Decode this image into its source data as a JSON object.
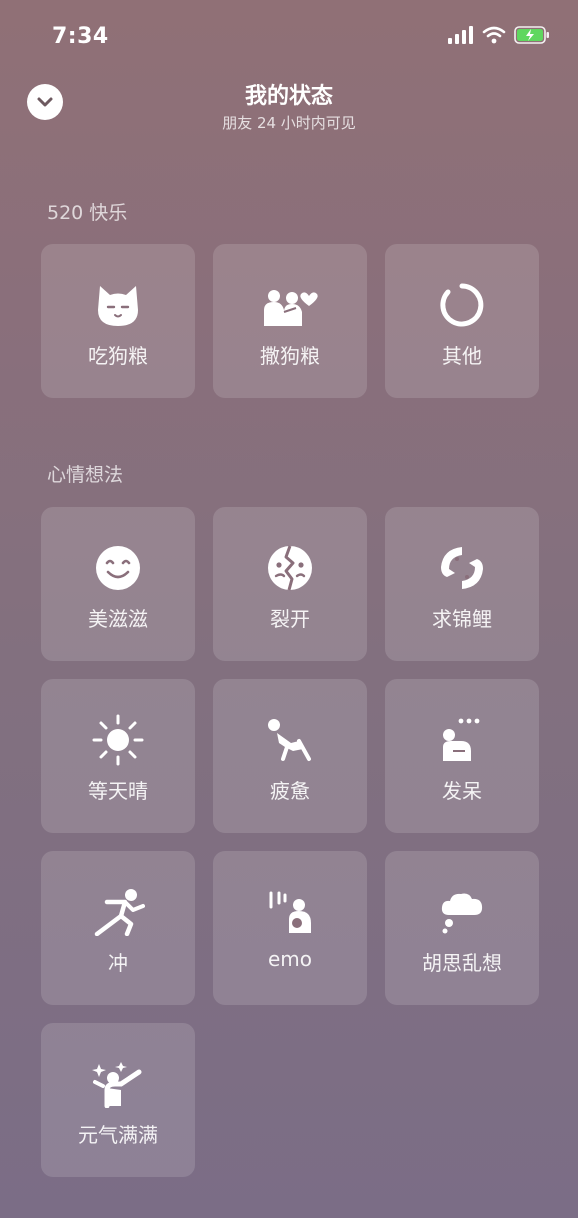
{
  "status_bar": {
    "time": "7:34"
  },
  "header": {
    "title": "我的状态",
    "subtitle": "朋友 24 小时内可见"
  },
  "sections": [
    {
      "title": "520 快乐",
      "items": [
        {
          "label": "吃狗粮",
          "icon": "cat-face-icon"
        },
        {
          "label": "撒狗粮",
          "icon": "couple-heart-icon"
        },
        {
          "label": "其他",
          "icon": "circle-icon"
        }
      ]
    },
    {
      "title": "心情想法",
      "items": [
        {
          "label": "美滋滋",
          "icon": "smile-icon"
        },
        {
          "label": "裂开",
          "icon": "cracked-face-icon"
        },
        {
          "label": "求锦鲤",
          "icon": "koi-fish-icon"
        },
        {
          "label": "等天晴",
          "icon": "sun-icon"
        },
        {
          "label": "疲惫",
          "icon": "tired-person-icon"
        },
        {
          "label": "发呆",
          "icon": "daze-person-icon"
        },
        {
          "label": "冲",
          "icon": "running-person-icon"
        },
        {
          "label": "emo",
          "icon": "emo-person-icon"
        },
        {
          "label": "胡思乱想",
          "icon": "thought-cloud-icon"
        },
        {
          "label": "元气满满",
          "icon": "energetic-person-icon"
        }
      ]
    }
  ]
}
